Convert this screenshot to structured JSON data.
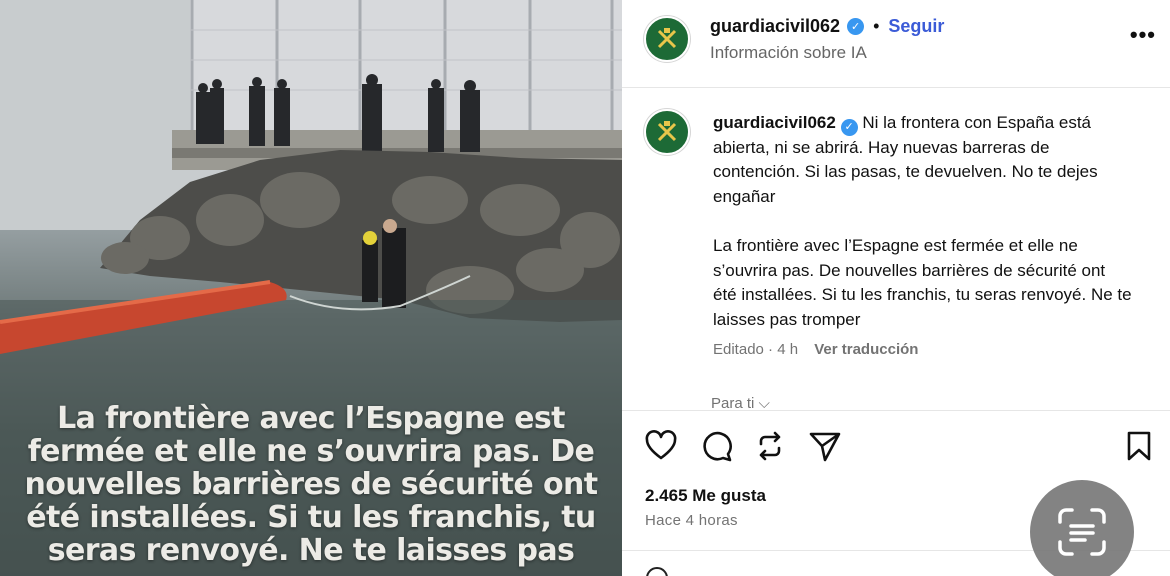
{
  "post": {
    "username": "guardiacivil062",
    "follow_label": "Seguir",
    "separator": "•",
    "ai_info": "Información sobre IA",
    "more_label": "•••",
    "caption_es": "Ni la frontera con España está abierta, ni se abrirá. Hay nuevas barreras de contención. Si las pasas, te devuelven. No te dejes engañar",
    "caption_fr": "La frontière avec l’Espagne est fermée et elle ne s’ouvrira pas. De nouvelles barrières de sécurité ont été installées. Si tu les franchis, tu seras renvoyé. Ne te laisses pas tromper",
    "edited_label": "Editado · 4 h",
    "translate_label": "Ver traducción",
    "for_you_label": "Para ti ⌵",
    "likes": "2.465 Me gusta",
    "time_ago": "Hace 4 horas"
  },
  "photo": {
    "overlay_text": "La frontière avec l’Espagne est fermée et elle ne s’ouvrira pas. De nouvelles barrières de sécurité ont été installées. Si tu les franchis, tu seras renvoyé. Ne te laisses pas"
  },
  "icons": {
    "like": "heart-icon",
    "comment": "comment-icon",
    "repost": "repost-icon",
    "share": "send-icon",
    "save": "bookmark-icon",
    "scan": "text-scan-icon",
    "verified": "verified-badge-icon"
  },
  "colors": {
    "follow": "#3b5bd7",
    "verified": "#3897f0",
    "avatar_bg": "#1d6a36",
    "muted_text": "#737373"
  }
}
